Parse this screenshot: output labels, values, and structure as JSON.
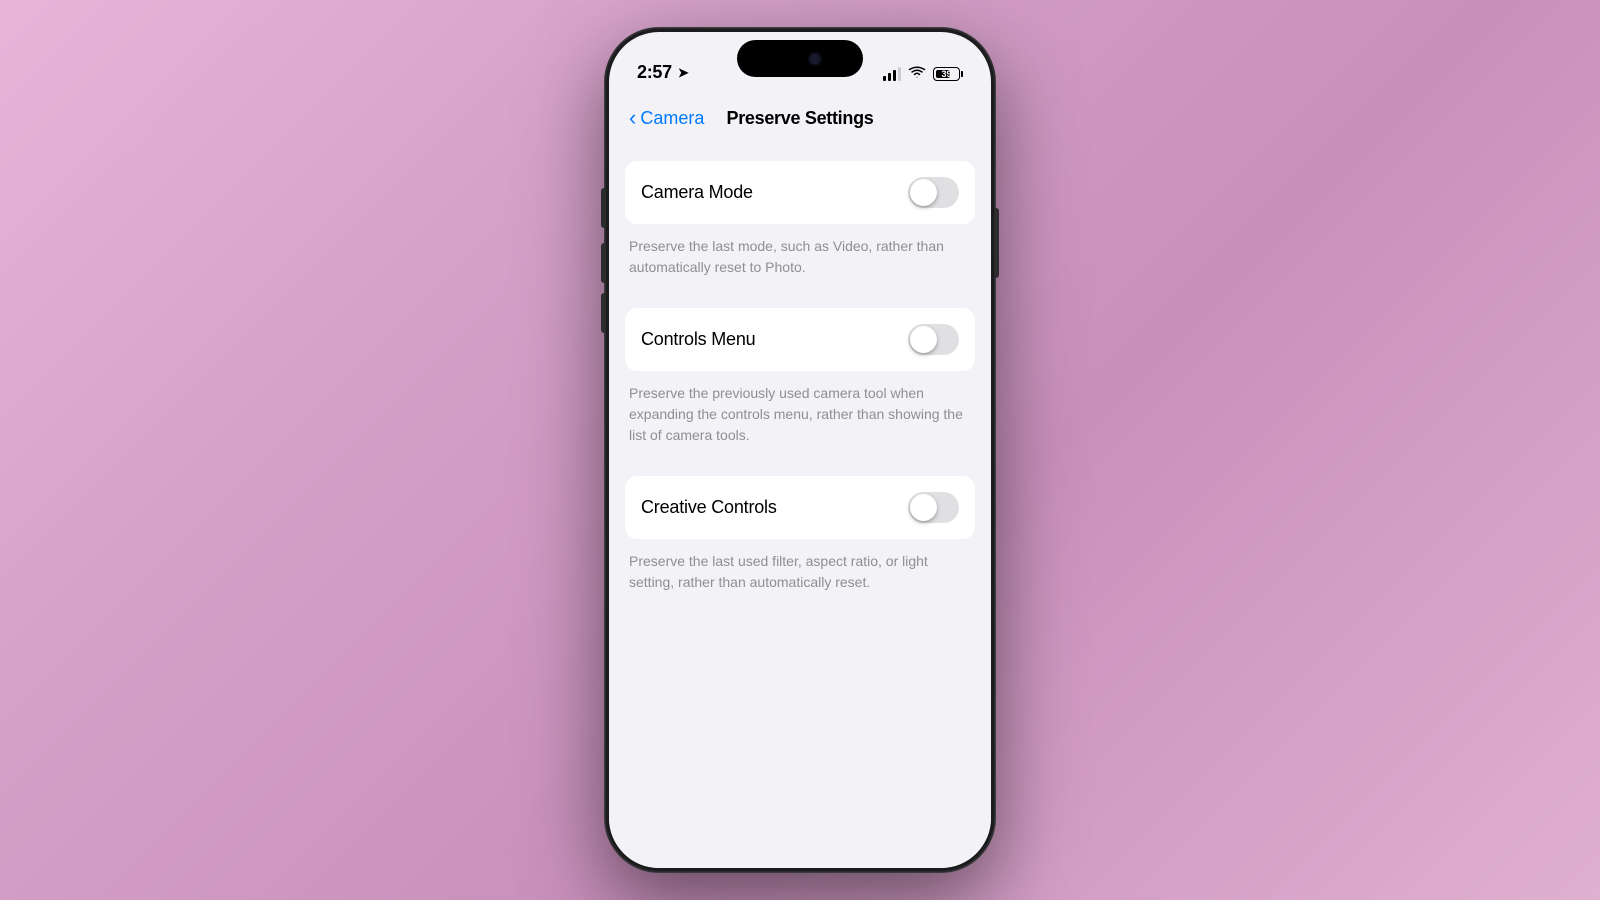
{
  "background": {
    "gradient_start": "#e8b4d8",
    "gradient_end": "#c890bc"
  },
  "status_bar": {
    "time": "2:57",
    "battery_percent": "39",
    "has_location": true
  },
  "navigation": {
    "back_label": "Camera",
    "title": "Preserve Settings"
  },
  "settings": [
    {
      "id": "camera_mode",
      "label": "Camera Mode",
      "toggle_state": false,
      "description": "Preserve the last mode, such as Video, rather than automatically reset to Photo."
    },
    {
      "id": "controls_menu",
      "label": "Controls Menu",
      "toggle_state": false,
      "description": "Preserve the previously used camera tool when expanding the controls menu, rather than showing the list of camera tools."
    },
    {
      "id": "creative_controls",
      "label": "Creative Controls",
      "toggle_state": false,
      "description": "Preserve the last used filter, aspect ratio, or light setting, rather than automatically reset."
    }
  ]
}
